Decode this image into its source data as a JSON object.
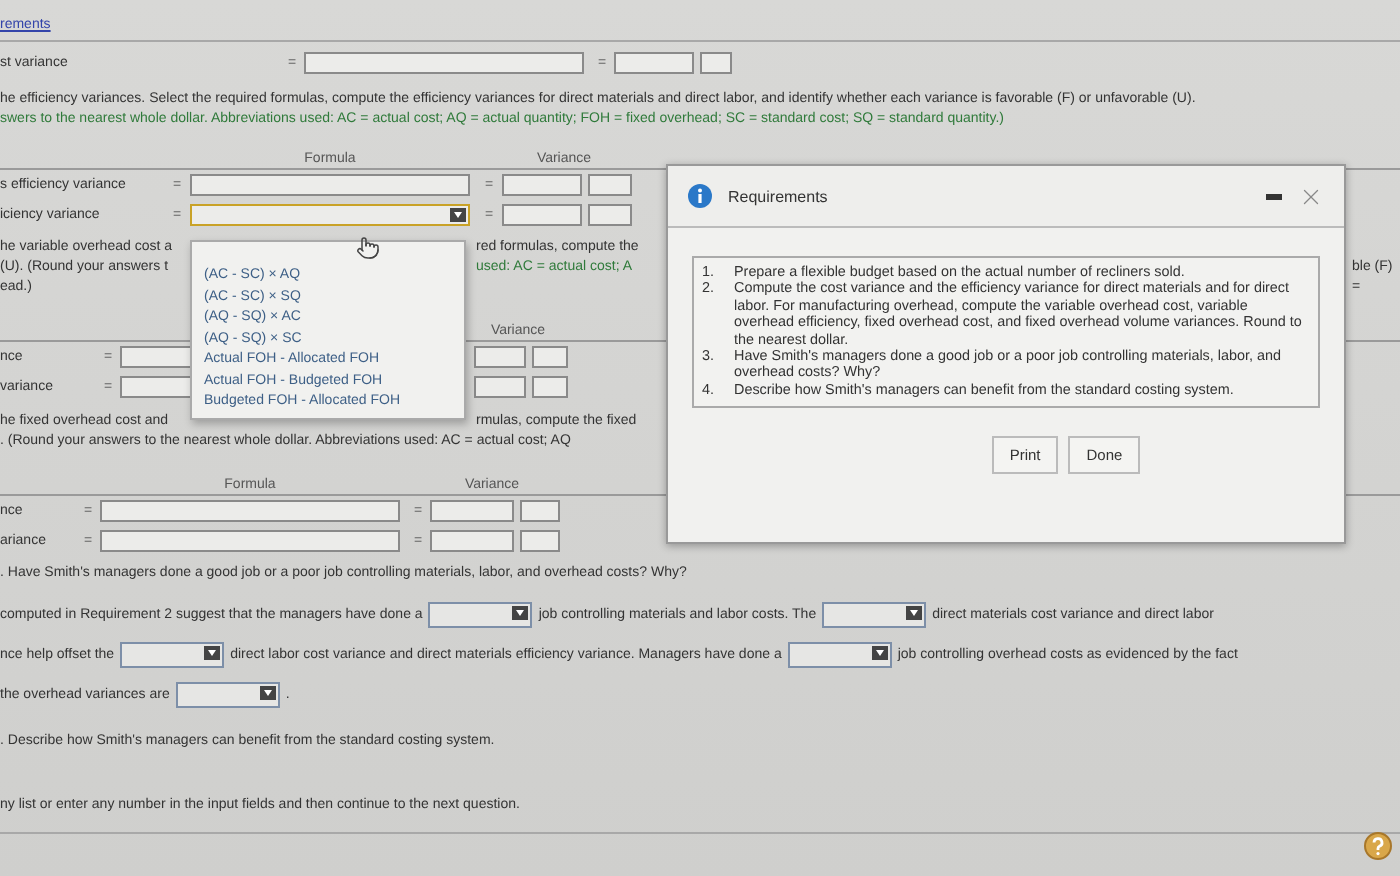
{
  "top_link": "rements",
  "cost_row": {
    "label": "st variance",
    "equals": [
      "=",
      "="
    ]
  },
  "instructions": {
    "line_1": "he efficiency variances. Select the required formulas, compute the efficiency variances for direct materials and direct labor, and identify whether each variance is favorable (F) or unfavorable (U).",
    "line_2": "swers to the nearest whole dollar. Abbreviations used: AC = actual cost; AQ = actual quantity; FOH = fixed overhead; SC = standard cost; SQ = standard quantity.)"
  },
  "section_1": {
    "formula_header": "Formula",
    "variance_header": "Variance",
    "rows": [
      {
        "label": "s efficiency variance",
        "equals": [
          "=",
          "="
        ],
        "kind": "input"
      },
      {
        "label": "iciency variance",
        "equals": [
          "=",
          "="
        ],
        "kind": "select",
        "open": true,
        "options": [
          "(AC - SC) × AQ",
          "(AC - SC) × SQ",
          "(AQ - SQ) × AC",
          "(AQ - SQ) × SC",
          "Actual FOH - Allocated FOH",
          "Actual FOH - Budgeted FOH",
          "Budgeted FOH - Allocated FOH"
        ]
      }
    ]
  },
  "variable_overhead_text": [
    {
      "left": "he variable overhead cost a",
      "right": "red formulas, compute the"
    },
    {
      "left": "(U). (Round your answers t",
      "right": "used: AC = actual cost; A",
      "far_right": "ble (F)"
    },
    {
      "left": "ead.)",
      "far_right": "="
    }
  ],
  "section_2": {
    "variance_header": "Variance",
    "rows": [
      {
        "label": "nce",
        "equals": [
          "="
        ],
        "kind": "input"
      },
      {
        "label": "variance",
        "equals": [
          "="
        ],
        "kind": "input"
      }
    ]
  },
  "fixed_overhead_text": [
    {
      "left": "he fixed overhead cost and",
      "right": "rmulas, compute the fixed"
    },
    {
      "left": ". (Round your answers to the nearest whole dollar. Abbreviations used: AC = actual cost; AQ"
    }
  ],
  "section_3": {
    "formula_header": "Formula",
    "variance_header": "Variance",
    "rows": [
      {
        "label": "nce",
        "equals": [
          "=",
          "="
        ],
        "kind": "input"
      },
      {
        "label": "ariance",
        "equals": [
          "=",
          "="
        ],
        "kind": "input"
      }
    ]
  },
  "requirement_3": {
    "heading": ". Have Smith's managers done a good job or a poor job controlling materials, labor, and overhead costs? Why?",
    "lines": [
      [
        {
          "kind": "text",
          "text": "computed in Requirement 2 suggest that the managers have done a"
        },
        {
          "kind": "select"
        },
        {
          "kind": "text",
          "text": "job controlling materials and labor costs. The"
        },
        {
          "kind": "select"
        },
        {
          "kind": "text",
          "text": "direct materials cost variance and direct labor"
        }
      ],
      [
        {
          "kind": "text",
          "text": "nce help offset the"
        },
        {
          "kind": "select"
        },
        {
          "kind": "text",
          "text": "direct labor cost variance and direct materials efficiency variance. Managers have done a"
        },
        {
          "kind": "select"
        },
        {
          "kind": "text",
          "text": "job controlling overhead costs as evidenced by the fact"
        }
      ],
      [
        {
          "kind": "text",
          "text": "the overhead variances are"
        },
        {
          "kind": "select"
        },
        {
          "kind": "text",
          "text": "."
        }
      ]
    ]
  },
  "requirement_4": {
    "heading": ". Describe how Smith's managers can benefit from the standard costing system."
  },
  "footer": "ny list or enter any number in the input fields and then continue to the next question.",
  "dialog": {
    "title": "Requirements",
    "items": [
      {
        "number": "1.",
        "text": "Prepare a flexible budget based on the actual number of recliners sold."
      },
      {
        "number": "2.",
        "text": "Compute the cost variance and the efficiency variance for direct materials and for direct labor. For manufacturing overhead, compute the variable overhead cost, variable overhead efficiency, fixed overhead cost, and fixed overhead volume variances. Round to the nearest dollar."
      },
      {
        "number": "3.",
        "text": "Have Smith's managers done a good job or a poor job controlling materials, labor, and overhead costs? Why?"
      },
      {
        "number": "4.",
        "text": "Describe how Smith's managers can benefit from the standard costing system."
      }
    ],
    "buttons": [
      "Print",
      "Done"
    ]
  }
}
